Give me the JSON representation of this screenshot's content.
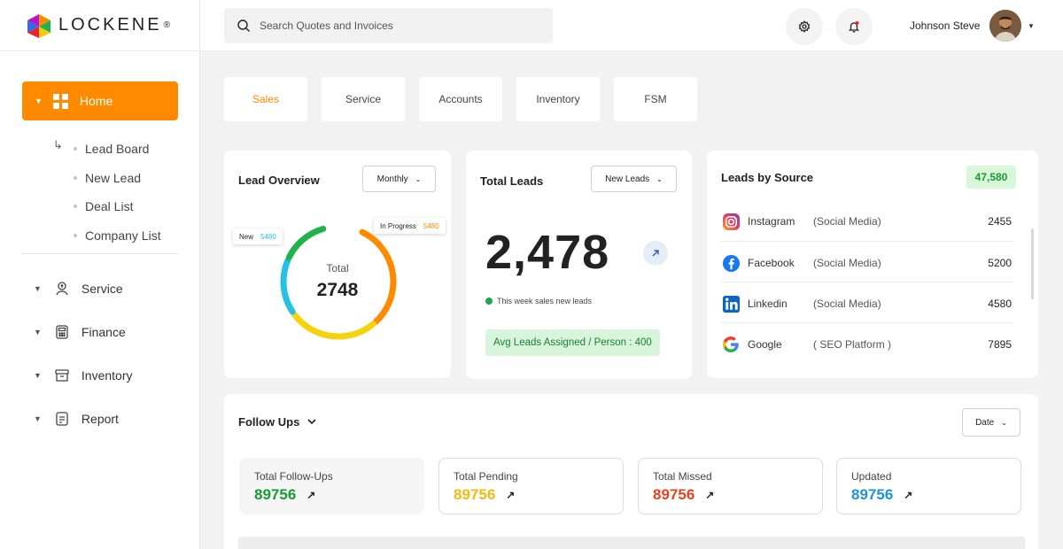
{
  "brand": {
    "name": "LOCKENE",
    "reg": "®"
  },
  "sidebar": {
    "home": {
      "label": "Home"
    },
    "sub_items": [
      "Lead Board",
      "New Lead",
      "Deal List",
      "Company List"
    ],
    "sections": [
      {
        "label": "Service",
        "icon": "hand-coin-icon"
      },
      {
        "label": "Finance",
        "icon": "calculator-icon"
      },
      {
        "label": "Inventory",
        "icon": "archive-box-icon"
      },
      {
        "label": "Report",
        "icon": "report-icon"
      }
    ]
  },
  "header": {
    "search_placeholder": "Search Quotes and Invoices",
    "user_name": "Johnson Steve"
  },
  "tabs": [
    "Sales",
    "Service",
    "Accounts",
    "Inventory",
    "FSM"
  ],
  "lead_overview": {
    "title": "Lead Overview",
    "period": "Monthly",
    "total_label": "Total",
    "total_value": "2748",
    "tip_new": {
      "label": "New",
      "value": "5480"
    },
    "tip_progress": {
      "label": "In Progress",
      "value": "5480"
    }
  },
  "total_leads": {
    "title": "Total Leads",
    "filter": "New Leads",
    "value": "2,478",
    "note": "This week sales new leads",
    "avg": "Avg Leads Assigned / Person : 400"
  },
  "leads_by_source": {
    "title": "Leads by Source",
    "total": "47,580",
    "rows": [
      {
        "name": "Instagram",
        "type": "(Social Media)",
        "value": "2455",
        "icon": "instagram-icon"
      },
      {
        "name": "Facebook",
        "type": "(Social Media)",
        "value": "5200",
        "icon": "facebook-icon"
      },
      {
        "name": "Linkedin",
        "type": "(Social Media)",
        "value": "4580",
        "icon": "linkedin-icon"
      },
      {
        "name": "Google",
        "type": "( SEO Platform )",
        "value": "7895",
        "icon": "google-icon"
      }
    ]
  },
  "follow_ups": {
    "title": "Follow Ups",
    "filter": "Date",
    "stats": [
      {
        "label": "Total Follow-Ups",
        "value": "89756",
        "color": "#1a9a33"
      },
      {
        "label": "Total Pending",
        "value": "89756",
        "color": "#f2b90f"
      },
      {
        "label": "Total Missed",
        "value": "89756",
        "color": "#e8421c"
      },
      {
        "label": "Updated",
        "value": "89756",
        "color": "#1e94d6"
      }
    ]
  },
  "colors": {
    "accent": "#ff8a00",
    "success": "#1ba94c"
  }
}
